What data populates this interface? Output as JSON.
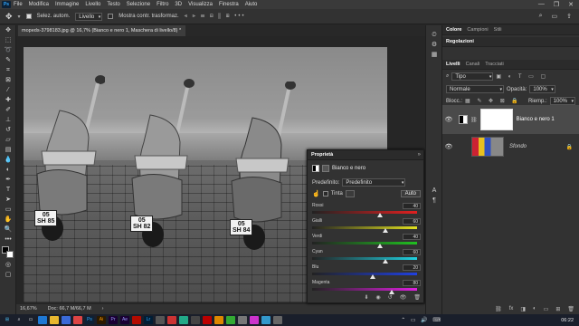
{
  "menubar": {
    "logo": "Ps",
    "items": [
      "File",
      "Modifica",
      "Immagine",
      "Livello",
      "Testo",
      "Selezione",
      "Filtro",
      "3D",
      "Visualizza",
      "Finestra",
      "Aiuto"
    ]
  },
  "options_bar": {
    "auto_select_label": "Selez. autom.",
    "auto_select_value": "Livello",
    "transform_label": "Mostra contr. trasformaz."
  },
  "document": {
    "tab_title": "mopeds-3798183.jpg @ 16,7% (Bianco e nero 1, Maschera di livello/8) *",
    "plates": [
      "05\nSH 85",
      "05\nSH 82",
      "05\nSH 84"
    ]
  },
  "status_bar": {
    "zoom": "16,67%",
    "doc_info": "Doc: 66,7 M/66,7 M"
  },
  "properties_panel": {
    "title": "Proprietà",
    "adjustment_name": "Bianco e nero",
    "preset_label": "Predefinito:",
    "preset_value": "Predefinito",
    "tint_label": "Tinta",
    "auto_label": "Auto",
    "sliders": [
      {
        "label": "Rossi",
        "value": 40,
        "fraction": 0.65,
        "gradient": [
          "#222",
          "#e02020"
        ]
      },
      {
        "label": "Gialli",
        "value": 60,
        "fraction": 0.7,
        "gradient": [
          "#222",
          "#e0e020"
        ]
      },
      {
        "label": "Verdi",
        "value": 40,
        "fraction": 0.65,
        "gradient": [
          "#222",
          "#20c020"
        ]
      },
      {
        "label": "Cyan",
        "value": 60,
        "fraction": 0.7,
        "gradient": [
          "#222",
          "#20d0e0"
        ]
      },
      {
        "label": "Blu",
        "value": 20,
        "fraction": 0.58,
        "gradient": [
          "#222",
          "#2040e0"
        ]
      },
      {
        "label": "Magenta",
        "value": 80,
        "fraction": 0.76,
        "gradient": [
          "#222",
          "#e020e0"
        ]
      }
    ]
  },
  "color_panel": {
    "tabs": [
      "Colore",
      "Campioni",
      "Stili"
    ],
    "active_tab": "Colore"
  },
  "adjust_panel": {
    "tabs": [
      "Regolazioni"
    ]
  },
  "layers_panel": {
    "tabs": [
      "Livelli",
      "Canali",
      "Tracciati"
    ],
    "active_tab": "Livelli",
    "filter_value": "Tipo",
    "blend_mode": "Normale",
    "opacity_label": "Opacità:",
    "opacity_value": "100%",
    "lock_label": "Blocc.:",
    "fill_label": "Riemp.:",
    "fill_value": "100%",
    "layers": [
      {
        "name": "Bianco e nero 1",
        "selected": true
      },
      {
        "name": "Sfondo",
        "selected": false
      }
    ]
  },
  "taskbar": {
    "time": "06:22"
  },
  "colors": {
    "accent": "#31a8ff",
    "panel_bg": "#323232",
    "app_bg": "#282828"
  }
}
